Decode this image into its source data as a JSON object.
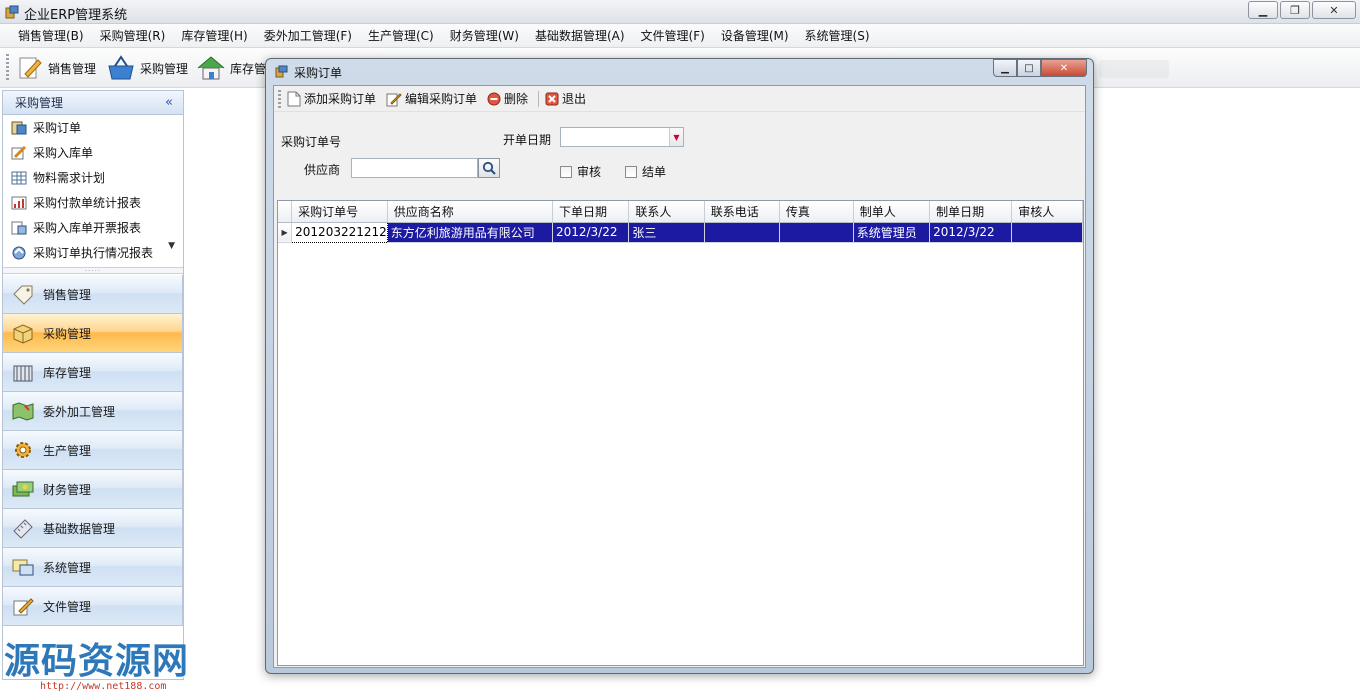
{
  "app": {
    "title": "企业ERP管理系统"
  },
  "menu": [
    "销售管理(B)",
    "采购管理(R)",
    "库存管理(H)",
    "委外加工管理(F)",
    "生产管理(C)",
    "财务管理(W)",
    "基础数据管理(A)",
    "文件管理(F)",
    "设备管理(M)",
    "系统管理(S)"
  ],
  "toolbar": {
    "sales": "销售管理",
    "purchase": "采购管理",
    "inventory": "库存管"
  },
  "nav": {
    "header": "采购管理",
    "collapse_glyph": "«",
    "items": [
      "采购订单",
      "采购入库单",
      "物料需求计划",
      "采购付款单统计报表",
      "采购入库单开票报表",
      "采购订单执行情况报表"
    ],
    "groups": [
      "销售管理",
      "采购管理",
      "库存管理",
      "委外加工管理",
      "生产管理",
      "财务管理",
      "基础数据管理",
      "系统管理",
      "文件管理"
    ]
  },
  "child": {
    "title": "采购订单",
    "toolbar": {
      "add": "添加采购订单",
      "edit": "编辑采购订单",
      "delete": "删除",
      "exit": "退出"
    },
    "form": {
      "order_no_label": "采购订单号",
      "open_date_label": "开单日期",
      "supplier_label": "供应商",
      "supplier_value": "",
      "audit_label": "审核",
      "settled_label": "结单",
      "audit_checked": false,
      "settled_checked": false
    },
    "grid": {
      "columns": [
        "采购订单号",
        "供应商名称",
        "下单日期",
        "联系人",
        "联系电话",
        "传真",
        "制单人",
        "制单日期",
        "审核人"
      ],
      "rows": [
        [
          "201203221212",
          "东方亿利旅游用品有限公司",
          "2012/3/22",
          "张三",
          "",
          "",
          "系统管理员",
          "2012/3/22",
          ""
        ]
      ],
      "selected_row": 0
    }
  },
  "watermark": {
    "text": "源码资源网",
    "url": "http://www.net188.com"
  },
  "colors": {
    "selection": "#1c1aa0",
    "active_group": "#ffb84d",
    "nav_header": "#d4e2f4",
    "watermark": "#2d78b9"
  }
}
